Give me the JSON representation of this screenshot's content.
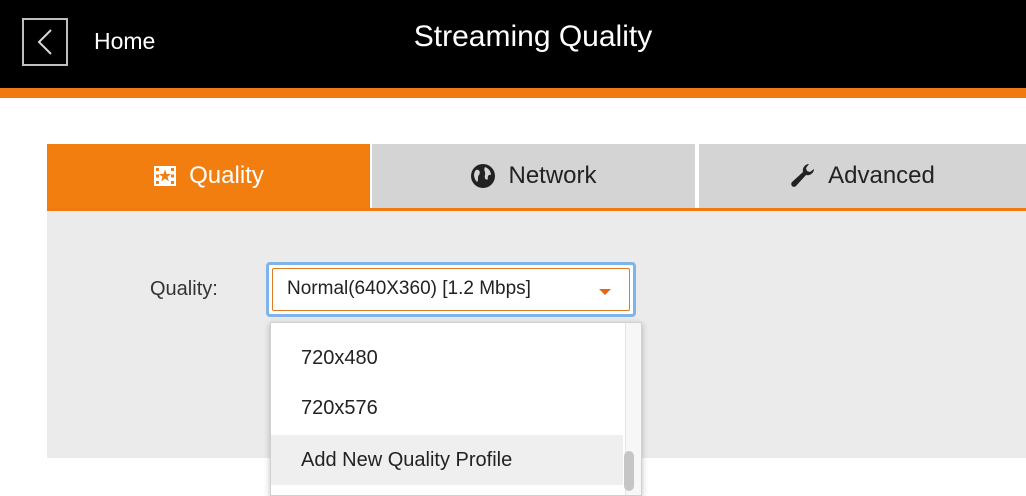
{
  "header": {
    "back_icon": "chevron-left-icon",
    "home_label": "Home",
    "title": "Streaming Quality"
  },
  "colors": {
    "accent": "#f07a10",
    "topbar": "#000000",
    "tab_inactive": "#d4d4d4",
    "panel": "#ebebeb",
    "focus_ring": "#7fb4ea"
  },
  "tabs": [
    {
      "label": "Quality",
      "icon": "film-star-icon",
      "active": true
    },
    {
      "label": "Network",
      "icon": "globe-icon",
      "active": false
    },
    {
      "label": "Advanced",
      "icon": "wrench-icon",
      "active": false
    }
  ],
  "quality_field": {
    "label": "Quality:",
    "selected_value": "Normal(640X360) [1.2 Mbps]",
    "caret_icon": "caret-down-icon"
  },
  "dropdown": {
    "options": [
      {
        "label": "720x480"
      },
      {
        "label": "720x576"
      },
      {
        "label": "Add New Quality Profile",
        "highlighted": true
      }
    ]
  }
}
